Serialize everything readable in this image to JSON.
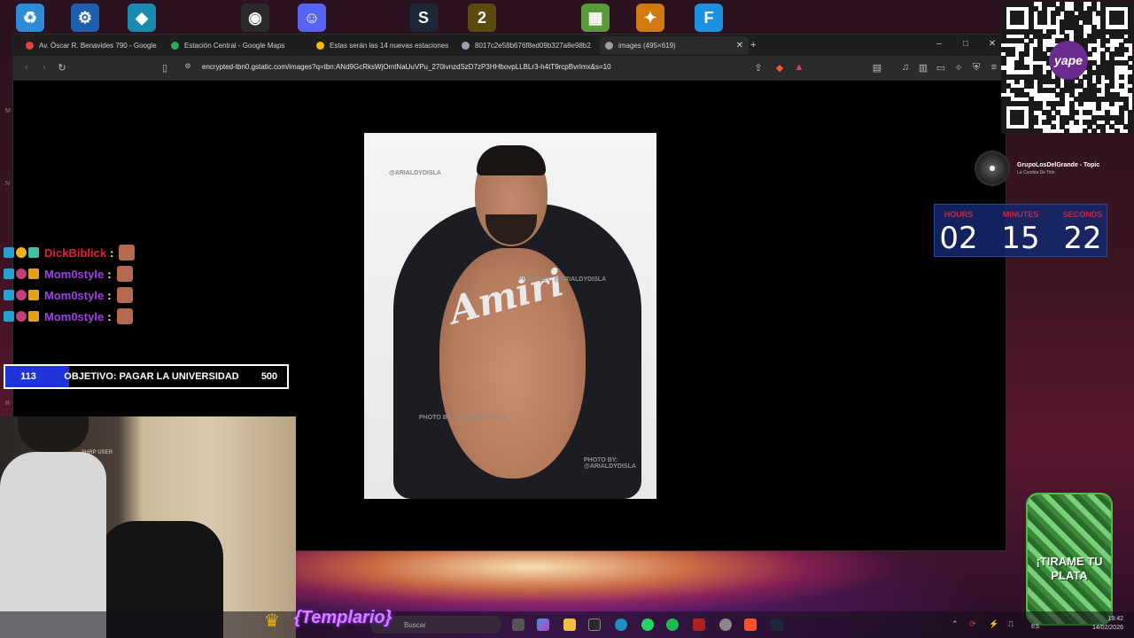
{
  "desktop": {
    "icons": [
      {
        "name": "recycle-bin",
        "color": "#2e8bd8",
        "glyph": "♻"
      },
      {
        "name": "app-blue",
        "color": "#1f5fb0",
        "glyph": "⚙"
      },
      {
        "name": "app-diamond",
        "color": "#1a8ab0",
        "glyph": "◆"
      },
      {
        "name": "obs",
        "color": "#2a2a2a",
        "glyph": "◉"
      },
      {
        "name": "discord",
        "color": "#5865f2",
        "glyph": "☺"
      },
      {
        "name": "steam",
        "color": "#1b2838",
        "glyph": "S"
      },
      {
        "name": "game-2",
        "color": "#5a4a10",
        "glyph": "2"
      },
      {
        "name": "minecraft",
        "color": "#5a9a3a",
        "glyph": "▦"
      },
      {
        "name": "cs",
        "color": "#d07a10",
        "glyph": "✦"
      },
      {
        "name": "fortnite",
        "color": "#1e90e0",
        "glyph": "F"
      }
    ]
  },
  "browser": {
    "tabs": [
      {
        "label": "Av. Óscar R. Benavides 790 - Google",
        "favicon_color": "#e94235",
        "active": false
      },
      {
        "label": "Estación Central - Google Maps",
        "favicon_color": "#34a853",
        "active": false
      },
      {
        "label": "Estas serán las 14 nuevas estaciones",
        "favicon_color": "#fbbc04",
        "active": false
      },
      {
        "label": "8017c2e58b676f8ed09b327a8e98b2",
        "favicon_color": "#9aa0a6",
        "active": false
      },
      {
        "label": "images (495×619)",
        "favicon_color": "#9aa0a6",
        "active": true
      }
    ],
    "new_tab": "+",
    "url": "encrypted-tbn0.gstatic.com/images?q=tbn:ANd9GcRksWjOmtNaUuVPu_270ivnzdSzD7zP3HHbovpLLBLr3-h4tT9rcpBvrImx&s=10",
    "image_watermarks": [
      "@ARIALDYDISLA",
      "PHOTO BY: @ARIALDYDISLA",
      "PHOTO BY: @ARIALDYDISLA",
      "PHOTO BY: @ARIALDYDISLA"
    ],
    "jacket_text": "Amiri"
  },
  "chat": {
    "messages": [
      {
        "user": "DickBiblick",
        "color": "#e0203a"
      },
      {
        "user": "Mom0style",
        "color": "#a040e0"
      },
      {
        "user": "Mom0style",
        "color": "#a040e0"
      },
      {
        "user": "Mom0style",
        "color": "#a040e0"
      }
    ],
    "separator": ":"
  },
  "goal": {
    "current": "113",
    "label": "OBJETIVO: PAGAR LA UNIVERSIDAD",
    "target": "500",
    "progress": 0.226
  },
  "webcam": {
    "label": "SHRP USER"
  },
  "music": {
    "title": "GrupoLosDelGrande - Topic",
    "subtitle": "La Cumbia De Titin"
  },
  "timer": {
    "labels": [
      "HOURS",
      "MINUTES",
      "SECONDS"
    ],
    "values": [
      "02",
      "15",
      "22"
    ]
  },
  "qr": {
    "badge": "yape"
  },
  "overlay": {
    "templario": "{Templario}",
    "plata": "¡TIRAME TU PLATA"
  },
  "taskbar": {
    "search_placeholder": "Buscar",
    "lang": "ES",
    "time": "19:42",
    "date": "14/02/2026"
  }
}
